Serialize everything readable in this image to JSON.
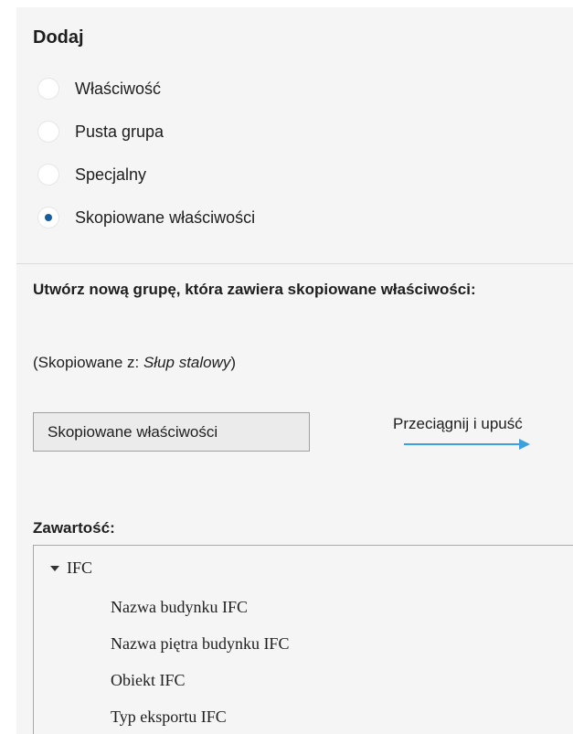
{
  "add_section": {
    "title": "Dodaj",
    "options": [
      {
        "label": "Właściwość",
        "selected": false
      },
      {
        "label": "Pusta grupa",
        "selected": false
      },
      {
        "label": "Specjalny",
        "selected": false
      },
      {
        "label": "Skopiowane właściwości",
        "selected": true
      }
    ]
  },
  "copied_section": {
    "description": "Utwórz nową grupę, która zawiera skopiowane właściwości:",
    "copied_from_prefix": "(Skopiowane z: ",
    "copied_from_source": "Słup stalowy",
    "copied_from_suffix": ")",
    "drag_item_label": "Skopiowane właściwości",
    "drag_hint": "Przeciągnij i upuść"
  },
  "contents": {
    "label": "Zawartość:",
    "tree": {
      "root_label": "IFC",
      "items": [
        "Nazwa budynku IFC",
        "Nazwa piętra budynku IFC",
        "Obiekt IFC",
        "Typ eksportu IFC"
      ]
    }
  },
  "colors": {
    "panel_background": "#f5f5f5",
    "radio_selected_dot": "#1a5d9e",
    "drag_arrow": "#3aa0e0"
  },
  "icons": {
    "tree_expander": "caret-down-icon",
    "drag_arrow": "arrow-right-icon"
  }
}
